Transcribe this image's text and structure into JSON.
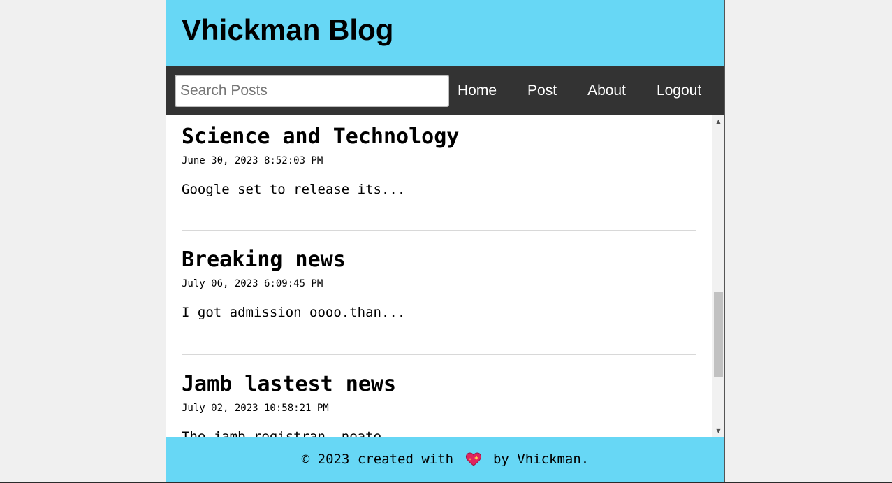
{
  "header": {
    "title": "Vhickman Blog",
    "background": "#67d7f5"
  },
  "navbar": {
    "search_placeholder": "Search Posts",
    "links": [
      {
        "label": "Home"
      },
      {
        "label": "Post"
      },
      {
        "label": "About"
      },
      {
        "label": "Logout"
      }
    ],
    "background": "#333333"
  },
  "posts": [
    {
      "title": "Science and Technology",
      "date": "June 30, 2023 8:52:03 PM",
      "excerpt": "Google set to release its..."
    },
    {
      "title": "Breaking news",
      "date": "July 06, 2023 6:09:45 PM",
      "excerpt": "I got admission oooo.than..."
    },
    {
      "title": "Jamb lastest news",
      "date": "July 02, 2023 10:58:21 PM",
      "excerpt": "The jamb registran, neate..."
    }
  ],
  "footer": {
    "prefix": "© 2023 created with ",
    "suffix": " by Vhickman.",
    "icon": "sparkling-heart-icon",
    "background": "#67d7f5"
  }
}
